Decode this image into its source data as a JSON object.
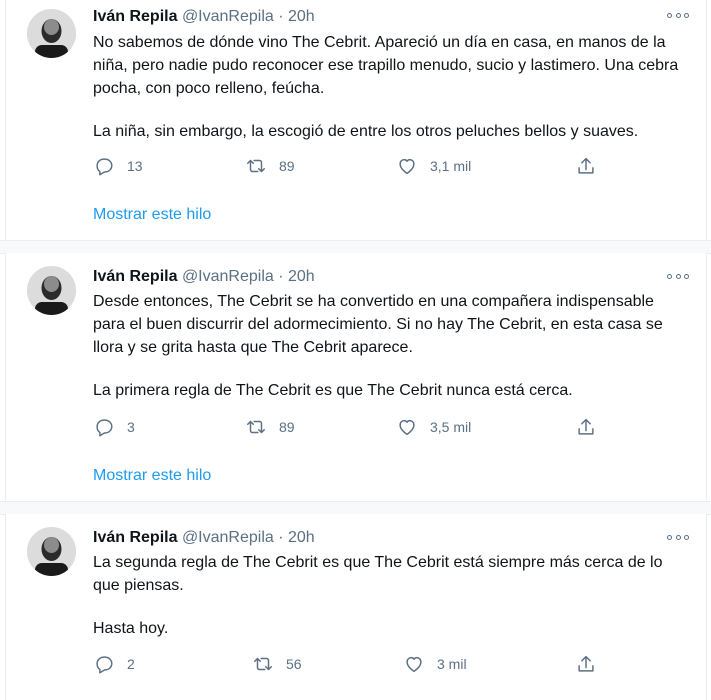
{
  "tweets": [
    {
      "name": "Iván Repila",
      "handle": "@IvanRepila",
      "time": "· 20h",
      "paragraphs": [
        "No sabemos de dónde vino The Cebrit. Apareció un día en casa, en manos de la niña, pero nadie pudo reconocer ese trapillo menudo, sucio y lastimero. Una cebra pocha, con poco relleno, feúcha.",
        "La niña, sin embargo, la escogió de entre los otros peluches bellos y suaves."
      ],
      "replies": "13",
      "retweets": "89",
      "likes": "3,1 mil",
      "thread_link": "Mostrar este hilo"
    },
    {
      "name": "Iván Repila",
      "handle": "@IvanRepila",
      "time": "· 20h",
      "paragraphs": [
        "Desde entonces, The Cebrit se ha convertido en una compañera indispensable para el buen discurrir del adormecimiento. Si no hay The Cebrit, en esta casa se llora y se grita hasta que The Cebrit aparece.",
        "La primera regla de The Cebrit es que The Cebrit nunca está cerca."
      ],
      "replies": "3",
      "retweets": "89",
      "likes": "3,5 mil",
      "thread_link": "Mostrar este hilo"
    },
    {
      "name": "Iván Repila",
      "handle": "@IvanRepila",
      "time": "· 20h",
      "paragraphs": [
        "La segunda regla de The Cebrit es que The Cebrit está siempre más cerca de lo que piensas.",
        "Hasta hoy."
      ],
      "replies": "2",
      "retweets": "56",
      "likes": "3 mil"
    }
  ],
  "icons": {
    "more": "more-horizontal-icon",
    "reply": "reply-icon",
    "retweet": "retweet-icon",
    "like": "heart-icon",
    "share": "share-icon"
  },
  "colors": {
    "link": "#1d9bf0",
    "secondary_text": "#5b7083",
    "separator": "#f7f9fa"
  }
}
